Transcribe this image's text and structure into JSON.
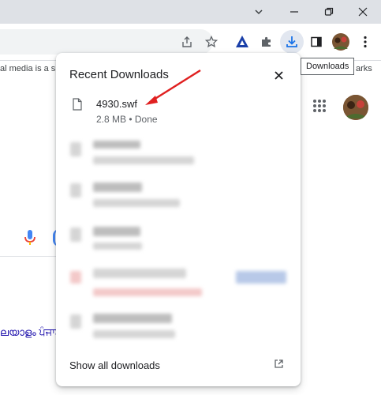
{
  "window": {
    "controls": [
      "chevron-down-icon",
      "minimize-icon",
      "restore-icon",
      "close-icon"
    ]
  },
  "toolbar": {
    "icons": [
      "share-icon",
      "star-icon",
      "extension-logo-icon",
      "puzzle-icon",
      "download-icon",
      "side-panel-icon",
      "profile-avatar",
      "menu-icon"
    ]
  },
  "bookmarks_bar": {
    "left_fragment": "al media is a s",
    "right_fragment": "arks"
  },
  "tooltip": {
    "text": "Downloads"
  },
  "page": {
    "language_fragment": "ലയാളം  ਪੰਜਾਬ"
  },
  "downloads": {
    "title": "Recent Downloads",
    "items": [
      {
        "name": "4930.swf",
        "status": "2.8 MB • Done"
      }
    ],
    "show_all_label": "Show all downloads"
  },
  "colors": {
    "accent": "#1a73e8",
    "annotation_arrow": "#e02020"
  }
}
